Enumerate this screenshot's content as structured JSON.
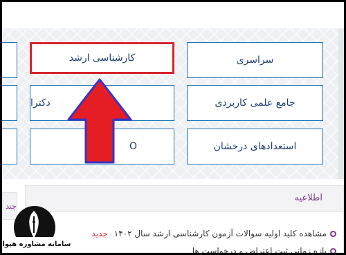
{
  "exam_buttons": {
    "sarasari": "سراسری",
    "arshad": "کارشناسی ارشد",
    "jame": "جامع علمی کاربردی",
    "doctora": "دکترا",
    "talent": "استعدادهای درخشان",
    "other": "O"
  },
  "news": {
    "title": "اطلاعیه",
    "items": [
      {
        "text": "مشاهده کلید اولیه سوالات آزمون کارشناسی ارشد سال ۱۴۰۲",
        "badge": "جدید"
      },
      {
        "text": "بازه زمانی ثبت اعتراض و درخواست ها",
        "badge": ""
      }
    ]
  },
  "side_tab": "چند",
  "logo": {
    "text": "سامانه مشاوره هپوا"
  },
  "colors": {
    "button_border": "#1f73b7",
    "highlight_border": "#d6242b",
    "arrow_fill": "#e51e25",
    "arrow_outline": "#3a33c4",
    "news_accent": "#7a3a86"
  }
}
